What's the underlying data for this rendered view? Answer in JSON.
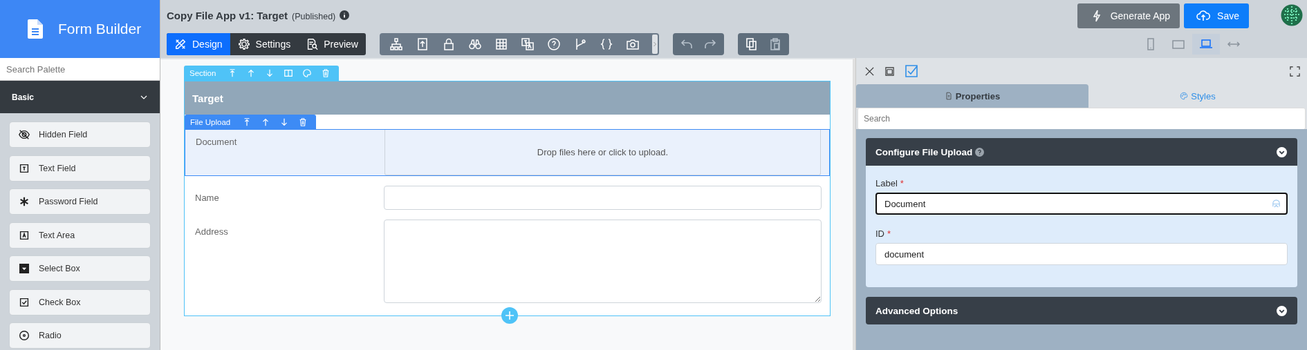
{
  "app": {
    "title": "Form Builder"
  },
  "palette": {
    "search": {
      "placeholder": "Search Palette"
    },
    "group": {
      "title": "Basic",
      "expanded": true
    },
    "items": [
      {
        "label": "Hidden Field",
        "kind": "hidden"
      },
      {
        "label": "Text Field",
        "kind": "text"
      },
      {
        "label": "Password Field",
        "kind": "password"
      },
      {
        "label": "Text Area",
        "kind": "textarea"
      },
      {
        "label": "Select Box",
        "kind": "select"
      },
      {
        "label": "Check Box",
        "kind": "checkbox"
      },
      {
        "label": "Radio",
        "kind": "radio"
      }
    ]
  },
  "header": {
    "title": "Copy File App v1: Target",
    "status": "(Published)"
  },
  "modes": [
    {
      "label": "Design",
      "kind": "design",
      "selected": true
    },
    {
      "label": "Settings",
      "kind": "settings",
      "selected": false
    },
    {
      "label": "Preview",
      "kind": "preview",
      "selected": false
    }
  ],
  "actions": [
    {
      "label": "Generate App",
      "kind": "generate"
    },
    {
      "label": "Save",
      "kind": "save"
    }
  ],
  "devices": [
    {
      "kind": "phone",
      "selected": false
    },
    {
      "kind": "tablet",
      "selected": false
    },
    {
      "kind": "laptop",
      "selected": true
    },
    {
      "kind": "full",
      "selected": false
    }
  ],
  "section": {
    "toolbar_label": "Section",
    "title": "Target",
    "component_label": "File Upload",
    "fields": [
      {
        "kind": "file",
        "label": "Document",
        "hint": "Drop files here or click to upload."
      },
      {
        "kind": "text",
        "label": "Name"
      },
      {
        "kind": "textarea",
        "label": "Address"
      }
    ]
  },
  "panel": {
    "tabs": [
      {
        "label": "Properties",
        "kind": "properties",
        "selected": true
      },
      {
        "label": "Styles",
        "kind": "styles",
        "selected": false
      }
    ],
    "search": {
      "placeholder": "Search"
    },
    "groups": [
      {
        "title": "Configure File Upload",
        "expanded": true,
        "fields": [
          {
            "label": "Label",
            "required": true,
            "required_mark": "*",
            "value": "Document",
            "focused": true
          },
          {
            "label": "ID",
            "required": true,
            "required_mark": "*",
            "value": "document",
            "focused": false
          }
        ]
      },
      {
        "title": "Advanced Options",
        "expanded": false
      }
    ]
  }
}
